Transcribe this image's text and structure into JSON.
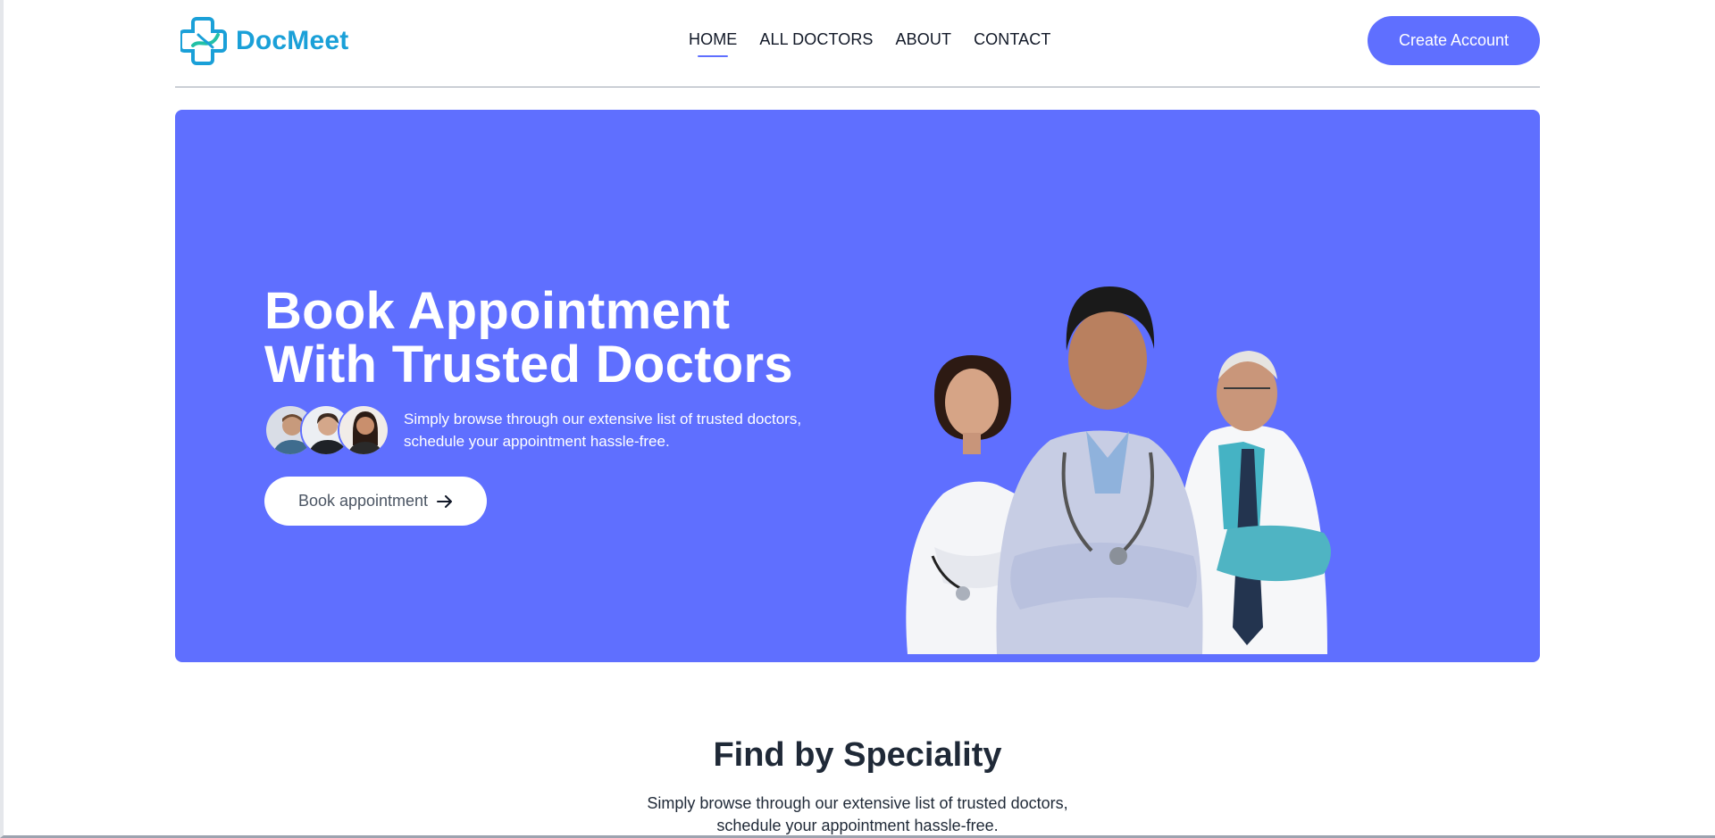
{
  "brand": {
    "name": "DocMeet",
    "primary_color": "#5f6fff",
    "logo_color": "#1aa0d8"
  },
  "nav": {
    "items": [
      {
        "label": "HOME",
        "active": true
      },
      {
        "label": "ALL DOCTORS",
        "active": false
      },
      {
        "label": "ABOUT",
        "active": false
      },
      {
        "label": "CONTACT",
        "active": false
      }
    ],
    "cta_label": "Create Account"
  },
  "hero": {
    "title_line1": "Book Appointment",
    "title_line2": "With Trusted Doctors",
    "desc_line1": "Simply browse through our extensive list of trusted doctors,",
    "desc_line2": "schedule your appointment hassle-free.",
    "button_label": "Book appointment",
    "button_icon": "arrow-right-icon"
  },
  "speciality": {
    "title": "Find by Speciality",
    "desc_line1": "Simply browse through our extensive list of trusted doctors,",
    "desc_line2": "schedule your appointment hassle-free."
  }
}
